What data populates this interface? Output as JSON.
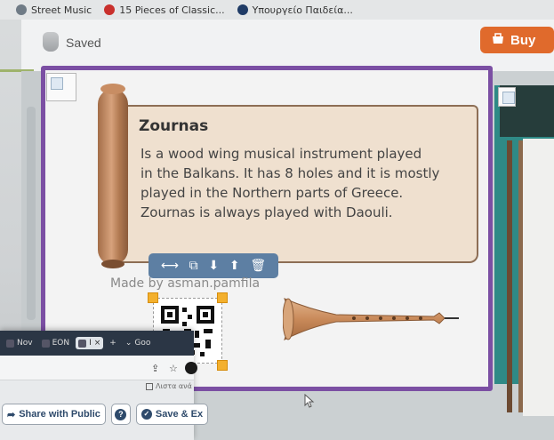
{
  "bookmarks": [
    {
      "label": "Street Music",
      "icon": "music-icon",
      "color": "#6f7b86"
    },
    {
      "label": "15 Pieces of Classic...",
      "icon": "record-icon",
      "color": "#c9302c"
    },
    {
      "label": "Υπουργείο Παιδεία...",
      "icon": "globe-icon",
      "color": "#1f3b66"
    }
  ],
  "header": {
    "saved_label": "Saved",
    "buy_label": "Buy",
    "buy_color": "#e06a2c"
  },
  "card": {
    "title": "Zournas",
    "body": "Is a wood wing musical instrument played in the Balkans. It has 8 holes and it is mostly played in the Northern parts of Greece. Zournas is always played with Daouli.",
    "body_lines": [
      "Is a wood wing musical instrument played",
      "in the Balkans. It has 8 holes and it is mostly",
      "played in the Northern parts of Greece.",
      "Zournas is always played with Daouli."
    ],
    "made_by": "Made by asman.pamfila",
    "frame_color": "#7b4fa3"
  },
  "toolbar": {
    "items": [
      {
        "icon": "resize-icon",
        "glyph": "⟷"
      },
      {
        "icon": "duplicate-icon",
        "glyph": "⧉"
      },
      {
        "icon": "move-down-icon",
        "glyph": "⬇"
      },
      {
        "icon": "move-up-icon",
        "glyph": "⬆"
      },
      {
        "icon": "trash-icon",
        "glyph": "🗑"
      }
    ],
    "color": "#5d7fa3"
  },
  "overlay": {
    "tabs": [
      "Nov",
      "EON",
      "I",
      "+"
    ],
    "address_hint": "Goo",
    "aux_label": "Λιστα ανά",
    "share_label": "Share with Public",
    "help_label": "?",
    "save_label": "Save & Ex"
  }
}
